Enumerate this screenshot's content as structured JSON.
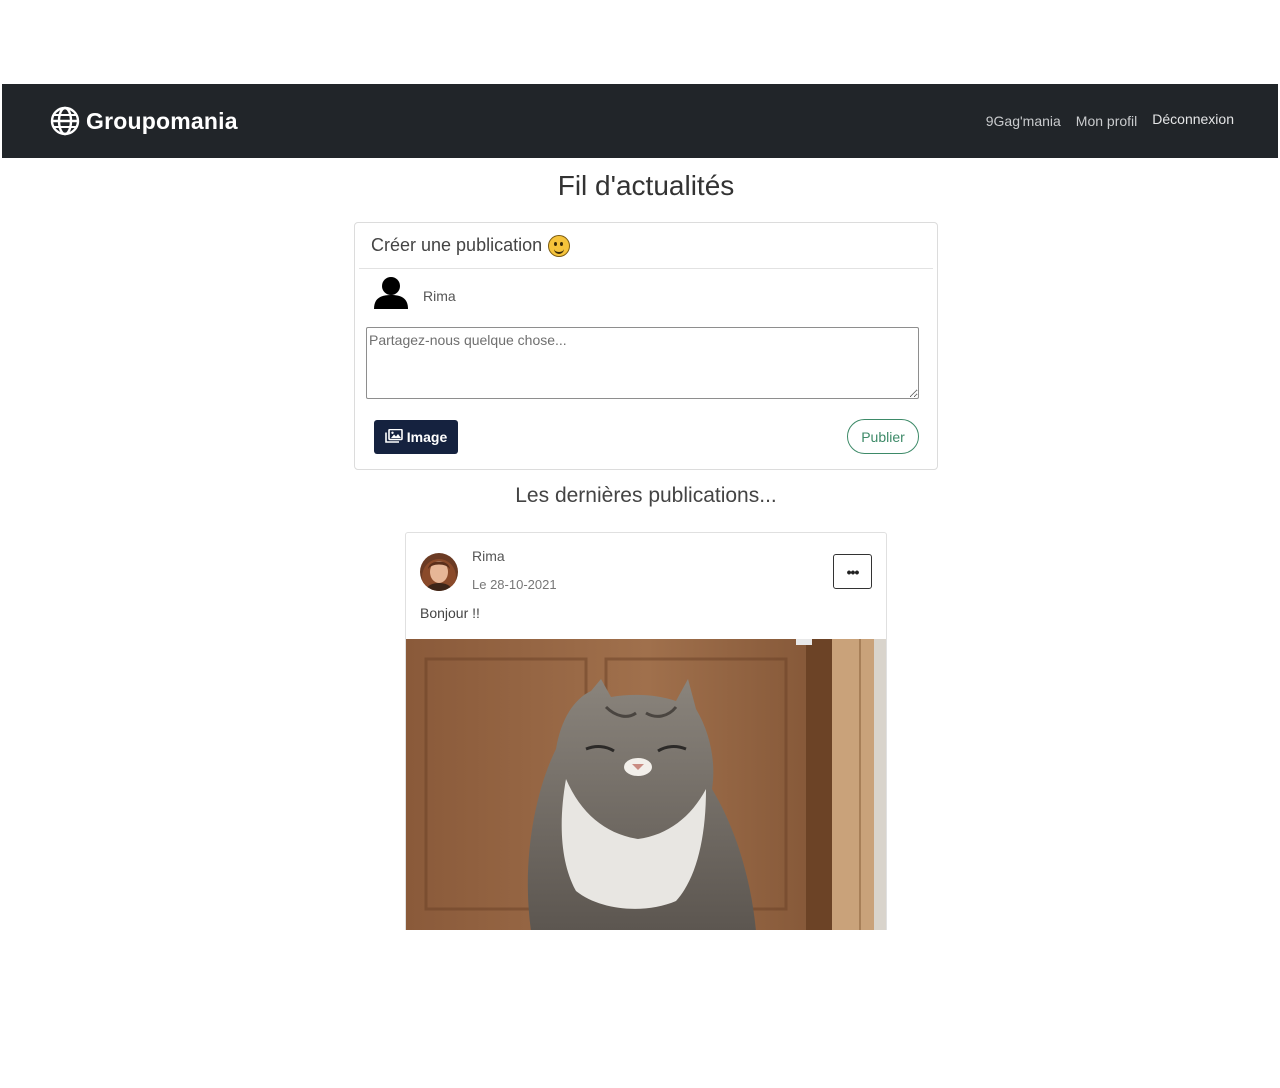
{
  "navbar": {
    "brand": "Groupomania",
    "brand_icon": "globe-icon",
    "links": [
      "9Gag'mania",
      "Mon profil"
    ],
    "logout": "Déconnexion",
    "background": "#212529"
  },
  "page": {
    "title": "Fil d'actualités"
  },
  "create_post": {
    "header": "Créer une publication",
    "header_icon": "smiley-emoji-icon",
    "author": "Rima",
    "author_icon": "user-silhouette-icon",
    "placeholder": "Partagez-nous quelque chose...",
    "image_button": "Image",
    "image_button_icon": "images-icon",
    "publish_button": "Publier",
    "colors": {
      "image_button": "#15223f",
      "publish_button": "#3d8a68"
    }
  },
  "feed": {
    "title": "Les dernières publications...",
    "posts": [
      {
        "author": "Rima",
        "date": "Le 28-10-2021",
        "text": "Bonjour !!",
        "options": "•••",
        "image_alt": "cat-photo"
      }
    ]
  }
}
